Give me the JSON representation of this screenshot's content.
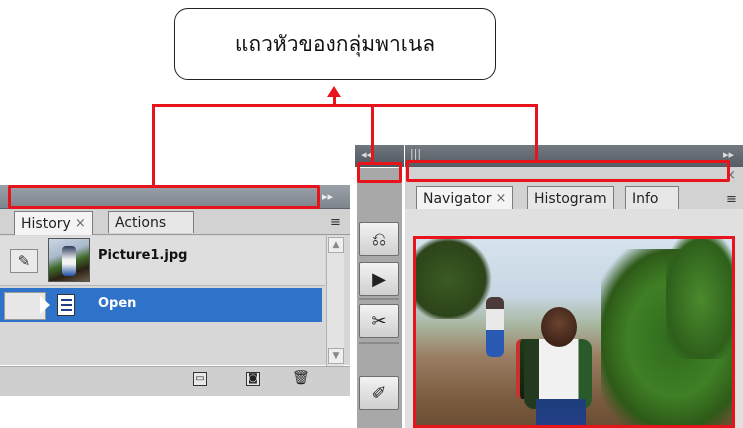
{
  "callout": {
    "text": "แถวหัวของกลุ่มพาเนล"
  },
  "left_panel": {
    "tabs": [
      {
        "label": "History",
        "close": "×",
        "active": true
      },
      {
        "label": "Actions",
        "close": "",
        "active": false
      }
    ],
    "collapse_arrows": "▸▸",
    "menu_icon": "≡",
    "snapshot": {
      "filename": "Picture1.jpg"
    },
    "steps": [
      {
        "label": "Open",
        "selected": true
      }
    ],
    "footer_icons": [
      "new-document-from-state-icon",
      "camera-snapshot-icon",
      "trash-icon"
    ]
  },
  "dock": {
    "collapse_arrows": "◂◂",
    "buttons": [
      "history-icon",
      "actions-play-icon",
      "tools-icon",
      "brush-icon"
    ]
  },
  "right_panel": {
    "collapse_arrows": "▸▸",
    "close": "×",
    "tabs": [
      {
        "label": "Navigator",
        "close": "×",
        "active": true
      },
      {
        "label": "Histogram",
        "close": "",
        "active": false
      },
      {
        "label": "Info",
        "close": "",
        "active": false
      }
    ],
    "menu_icon": "≡"
  },
  "colors": {
    "highlight_red": "#e8141b",
    "selection_blue": "#2f72c9"
  }
}
